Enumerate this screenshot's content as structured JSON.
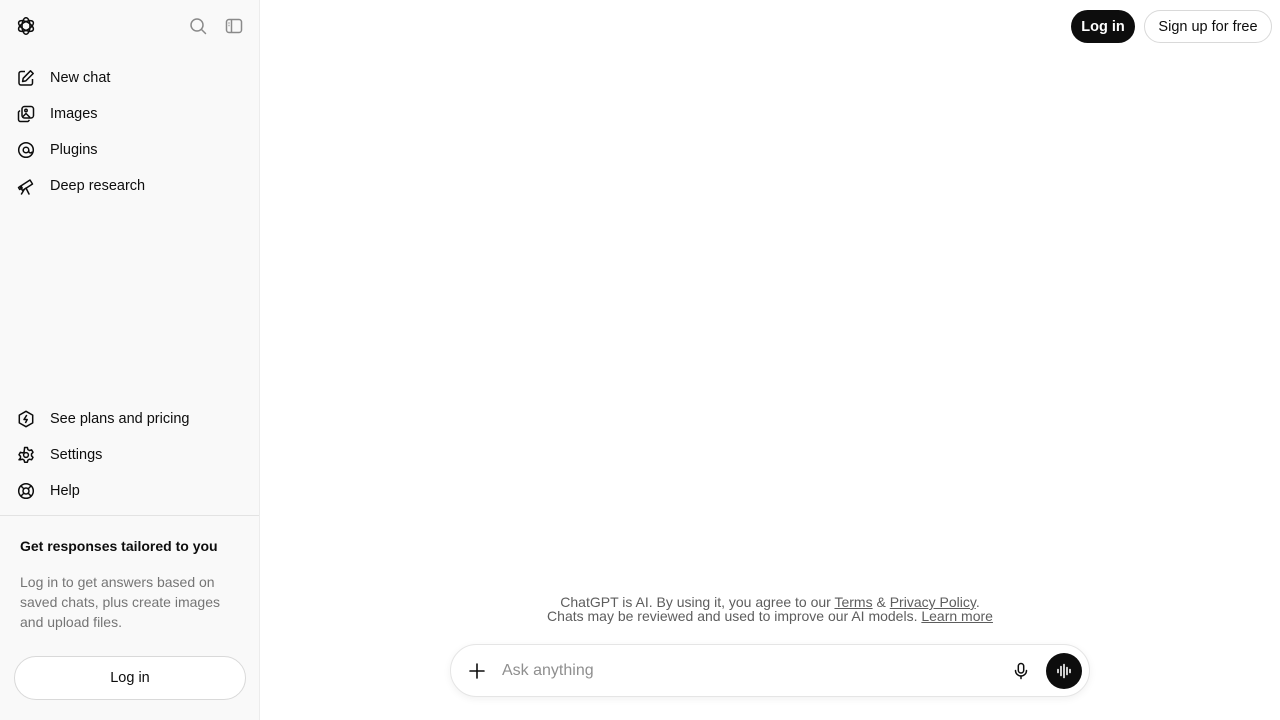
{
  "sidebar": {
    "logo_icon": "openai-logo-icon",
    "search_icon": "search-icon",
    "toggle_icon": "sidebar-toggle-icon",
    "top_items": [
      {
        "label": "New chat",
        "icon": "edit-icon"
      },
      {
        "label": "Images",
        "icon": "images-icon"
      },
      {
        "label": "Plugins",
        "icon": "plugins-icon"
      },
      {
        "label": "Deep research",
        "icon": "telescope-icon"
      }
    ],
    "bottom_items": [
      {
        "label": "See plans and pricing",
        "icon": "plans-icon"
      },
      {
        "label": "Settings",
        "icon": "gear-icon"
      },
      {
        "label": "Help",
        "icon": "help-icon"
      }
    ],
    "promo": {
      "title": "Get responses tailored to you",
      "text": "Log in to get answers based on saved chats, plus create images and upload files."
    },
    "login_label": "Log in"
  },
  "header": {
    "login_label": "Log in",
    "signup_label": "Sign up for free"
  },
  "disclaimer": {
    "line1_prefix": "ChatGPT is AI. By using it, you agree to our ",
    "terms": "Terms",
    "amp": " & ",
    "privacy": "Privacy Policy",
    "line1_suffix": ".",
    "line2_prefix": "Chats may be reviewed and used to improve our AI models. ",
    "learn_more": "Learn more"
  },
  "composer": {
    "placeholder": "Ask anything",
    "value": ""
  },
  "colors": {
    "sidebar_bg": "#f9f9f9",
    "primary_button": "#0d0d0d",
    "muted_text": "#757575"
  }
}
